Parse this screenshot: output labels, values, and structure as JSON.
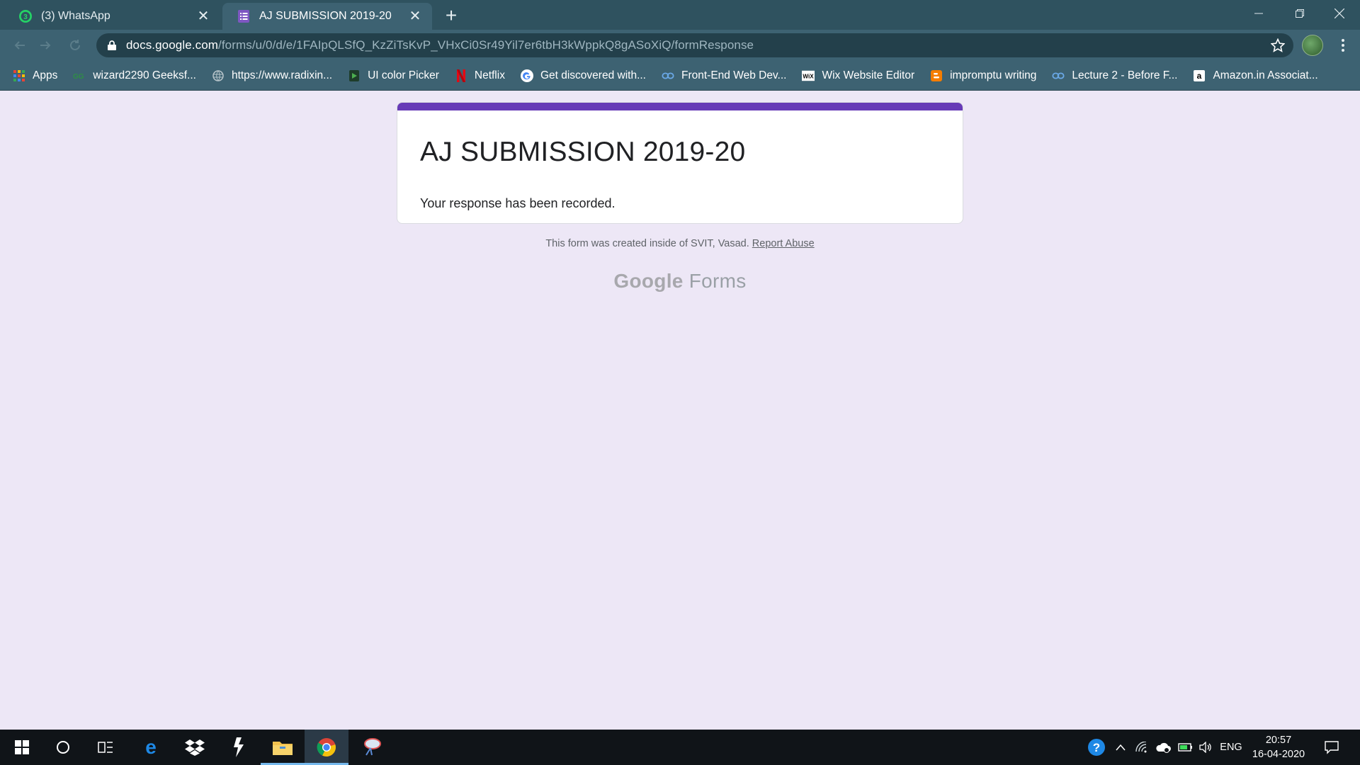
{
  "browser": {
    "tabs": [
      {
        "title": "(3) WhatsApp",
        "icon": "whatsapp-icon",
        "badge": "3"
      },
      {
        "title": "AJ SUBMISSION 2019-20",
        "icon": "google-forms-icon"
      }
    ],
    "address": {
      "host": "docs.google.com",
      "path": "/forms/u/0/d/e/1FAIpQLSfQ_KzZiTsKvP_VHxCi0Sr49Yil7er6tbH3kWppkQ8gASoXiQ/formResponse"
    },
    "bookmarks": [
      {
        "label": "Apps",
        "icon": "apps-grid-icon"
      },
      {
        "label": "wizard2290 Geeksf...",
        "icon": "geeksforgeeks-icon"
      },
      {
        "label": "https://www.radixin...",
        "icon": "globe-icon"
      },
      {
        "label": "UI color Picker",
        "icon": "color-picker-icon"
      },
      {
        "label": "Netflix",
        "icon": "netflix-icon"
      },
      {
        "label": "Get discovered with...",
        "icon": "google-icon"
      },
      {
        "label": "Front-End Web Dev...",
        "icon": "coursera-icon"
      },
      {
        "label": "Wix Website Editor",
        "icon": "wix-icon"
      },
      {
        "label": "impromptu writing",
        "icon": "blogger-icon"
      },
      {
        "label": "Lecture 2 - Before F...",
        "icon": "coursera-icon"
      },
      {
        "label": "Amazon.in Associat...",
        "icon": "amazon-icon"
      }
    ]
  },
  "form": {
    "title": "AJ SUBMISSION 2019-20",
    "confirmation": "Your response has been recorded.",
    "accent_color": "#673ab7"
  },
  "footer": {
    "note": "This form was created inside of SVIT, Vasad.",
    "report_link": "Report Abuse",
    "brand_google": "Google",
    "brand_forms": "Forms"
  },
  "taskbar": {
    "time": "20:57",
    "date": "16-04-2020",
    "language": "ENG"
  }
}
